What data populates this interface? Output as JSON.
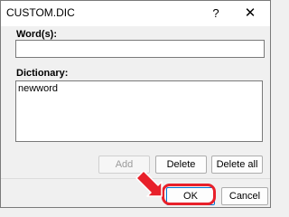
{
  "window": {
    "title": "CUSTOM.DIC",
    "help_label": "?",
    "close_label": "✕"
  },
  "words": {
    "label": "Word(s):",
    "value": ""
  },
  "dictionary": {
    "label": "Dictionary:",
    "items": [
      "newword"
    ]
  },
  "buttons": {
    "add": "Add",
    "delete": "Delete",
    "delete_all": "Delete all",
    "ok": "OK",
    "cancel": "Cancel"
  },
  "colors": {
    "highlight": "#e8202a",
    "accent": "#0078d4"
  },
  "annotations": {
    "arrow_icon": "red-arrow-pointing-to-ok"
  }
}
